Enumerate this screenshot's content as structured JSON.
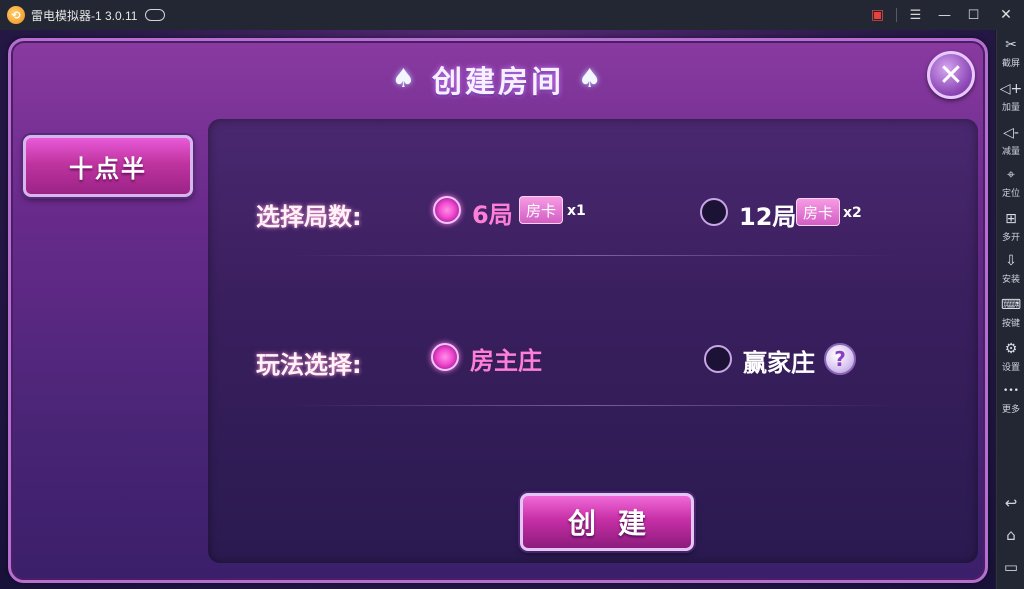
{
  "window": {
    "title": "雷电模拟器-1 3.0.11",
    "logo_char": "⟲"
  },
  "sidebar": {
    "items": [
      {
        "icon": "scissors-icon",
        "glyph": "✂",
        "label": "截屏"
      },
      {
        "icon": "volume-up-icon",
        "glyph": "◁+",
        "label": "加量"
      },
      {
        "icon": "volume-down-icon",
        "glyph": "◁-",
        "label": "减量"
      },
      {
        "icon": "location-icon",
        "glyph": "⌖",
        "label": "定位"
      },
      {
        "icon": "multi-open-icon",
        "glyph": "⊞",
        "label": "多开"
      },
      {
        "icon": "install-apk-icon",
        "glyph": "⇩",
        "label": "安装"
      },
      {
        "icon": "keyboard-icon",
        "glyph": "⌨",
        "label": "按键"
      },
      {
        "icon": "settings-icon",
        "glyph": "⚙",
        "label": "设置"
      },
      {
        "icon": "more-icon",
        "glyph": "•••",
        "label": "更多"
      }
    ],
    "bottom": [
      {
        "icon": "back-icon",
        "glyph": "↩"
      },
      {
        "icon": "home-icon",
        "glyph": "⌂"
      },
      {
        "icon": "recent-apps-icon",
        "glyph": "▭"
      }
    ]
  },
  "dialog": {
    "title": "创建房间",
    "spade": "♠",
    "close_glyph": "✕",
    "game_tab": "十点半",
    "rounds": {
      "label": "选择局数:",
      "options": [
        {
          "text": "6局",
          "badge": "房卡",
          "mult": "x1",
          "selected": true
        },
        {
          "text": "12局",
          "badge": "房卡",
          "mult": "x2",
          "selected": false
        }
      ]
    },
    "mode": {
      "label": "玩法选择:",
      "options": [
        {
          "text": "房主庄",
          "selected": true
        },
        {
          "text": "赢家庄",
          "selected": false
        }
      ],
      "help": "?"
    },
    "create_button": "创建"
  }
}
